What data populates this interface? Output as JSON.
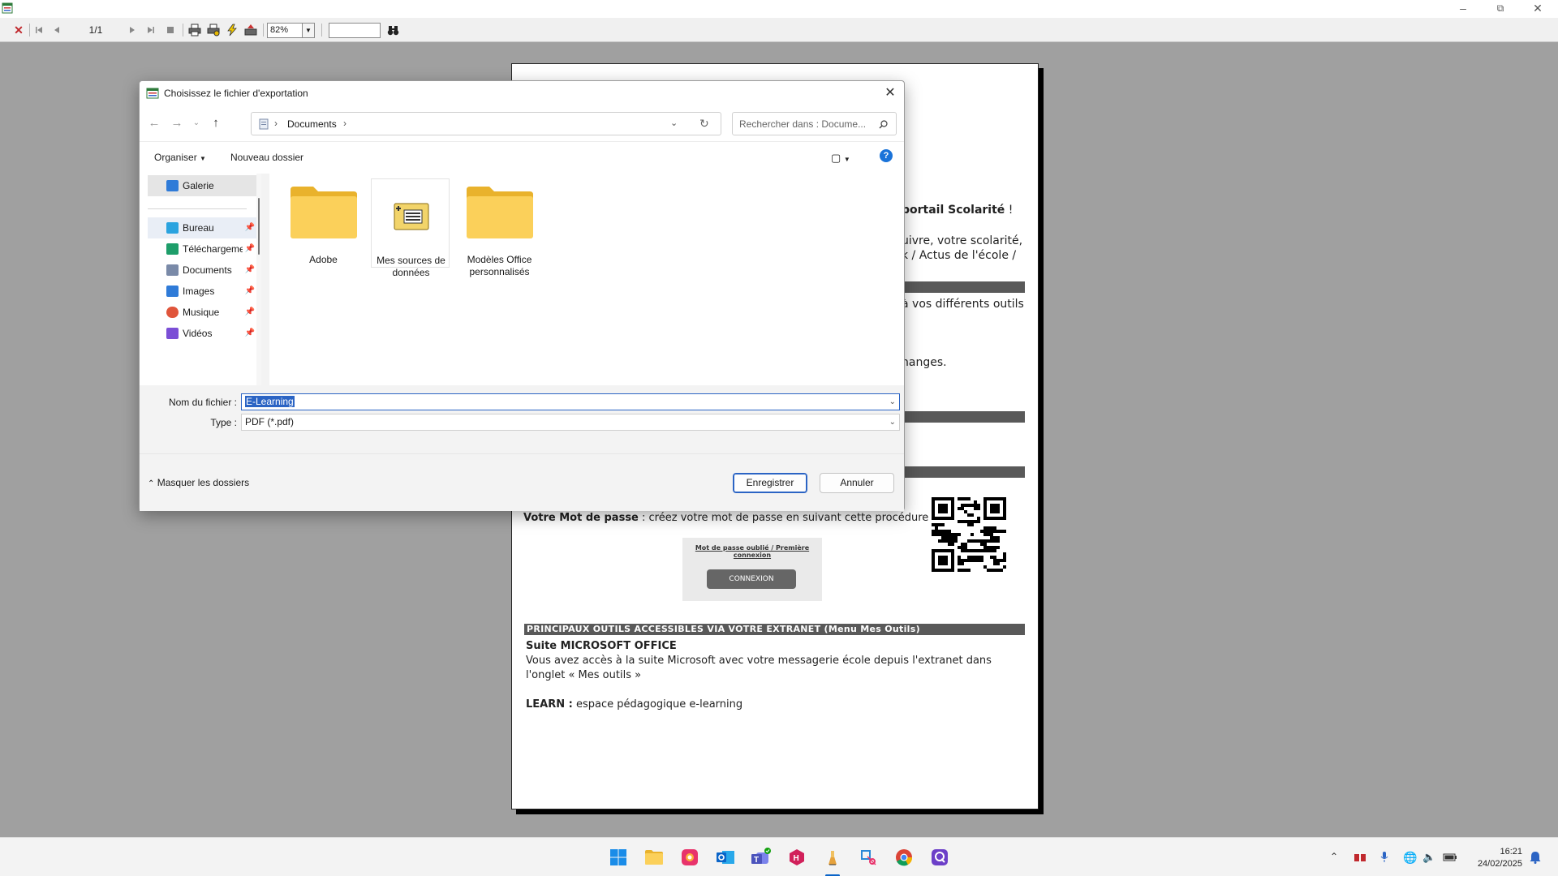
{
  "viewer": {
    "page_counter": "1/1",
    "zoom": "82%",
    "find_value": ""
  },
  "page": {
    "frag1_bold": "portail Scolarité",
    "frag1_tail": " !",
    "frag2": "uivre, votre scolarité,",
    "frag3": "k / Actus de l'école /",
    "frag4": "à vos différents outils",
    "frag5": "hanges.",
    "pwd_bold": "Votre Mot de passe",
    "pwd_rest": " : créez votre mot de passe en suivant cette procédure",
    "mock_link": "Mot de passe oublié / Première connexion",
    "mock_button": "CONNEXION",
    "section_bar": "PRINCIPAUX OUTILS ACCESSIBLES VIA VOTRE EXTRANET (Menu Mes Outils)",
    "suite_title": "Suite MICROSOFT OFFICE",
    "suite_line1": "Vous avez accès à la suite Microsoft avec votre messagerie école depuis l'extranet dans",
    "suite_line2": "l'onglet « Mes outils »",
    "learn_bold": "LEARN :",
    "learn_rest": " espace pédagogique e-learning"
  },
  "dialog": {
    "title": "Choisissez le fichier d'exportation",
    "address_path": "Documents",
    "search_placeholder": "Rechercher dans : Docume...",
    "organize": "Organiser",
    "new_folder": "Nouveau dossier",
    "sidebar": [
      {
        "label": "Galerie",
        "icon": "gallery-icon",
        "color": "#2f7bd8",
        "pinned": false
      },
      {
        "label": "Bureau",
        "icon": "desktop-icon",
        "color": "#2aa3df",
        "pinned": true
      },
      {
        "label": "Téléchargements",
        "icon": "download-icon",
        "color": "#1e9e6a",
        "pinned": true
      },
      {
        "label": "Documents",
        "icon": "document-icon",
        "color": "#7a8aa8",
        "pinned": true
      },
      {
        "label": "Images",
        "icon": "pictures-icon",
        "color": "#2f7bd8",
        "pinned": true
      },
      {
        "label": "Musique",
        "icon": "music-icon",
        "color": "#e0553b",
        "pinned": true
      },
      {
        "label": "Vidéos",
        "icon": "videos-icon",
        "color": "#7b4fd6",
        "pinned": true
      }
    ],
    "files": [
      {
        "label": "Adobe",
        "icon": "folder-icon"
      },
      {
        "label": "Mes sources de données",
        "icon": "data-source-icon"
      },
      {
        "label": "Modèles Office personnalisés",
        "icon": "folder-icon"
      }
    ],
    "filename_label": "Nom du fichier :",
    "filename_value": "E-Learning",
    "type_label": "Type :",
    "type_value": "PDF (*.pdf)",
    "hide_folders": "Masquer les dossiers",
    "save": "Enregistrer",
    "cancel": "Annuler"
  },
  "taskbar": {
    "apps": [
      "start-icon",
      "file-explorer-icon",
      "photos-icon",
      "outlook-icon",
      "teams-icon",
      "h-app-icon",
      "pen-app-icon",
      "snipping-tool-icon",
      "chrome-icon",
      "q-app-icon"
    ],
    "time": "16:21",
    "date": "24/02/2025"
  }
}
